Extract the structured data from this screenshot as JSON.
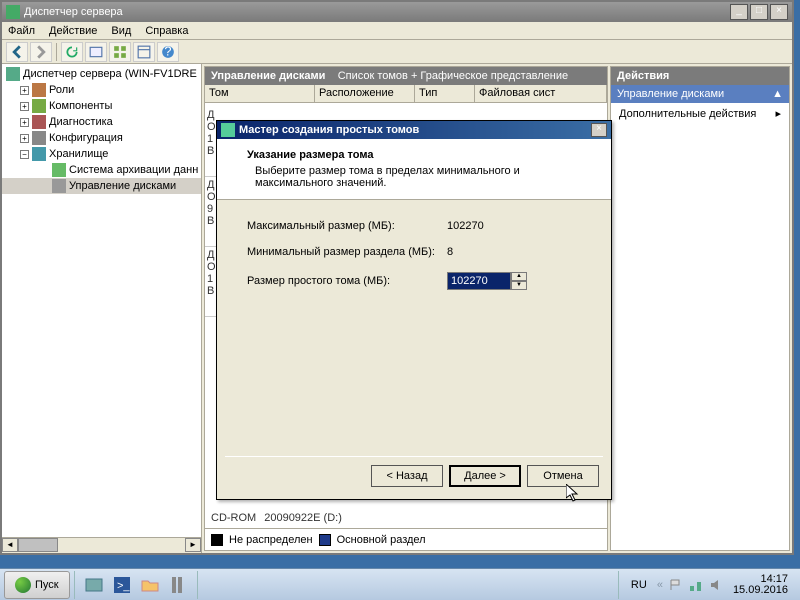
{
  "window": {
    "title": "Диспетчер сервера"
  },
  "winbuttons": {
    "min": "_",
    "max": "□",
    "close": "×"
  },
  "menu": {
    "file": "Файл",
    "action": "Действие",
    "view": "Вид",
    "help": "Справка"
  },
  "tree": {
    "root": "Диспетчер сервера (WIN-FV1DRE",
    "roles": "Роли",
    "components": "Компоненты",
    "diagnostics": "Диагностика",
    "config": "Конфигурация",
    "storage": "Хранилище",
    "backup": "Система архивации данн",
    "diskmgmt": "Управление дисками"
  },
  "diskheader": {
    "title": "Управление дисками",
    "subtitle": "Список томов + Графическое представление"
  },
  "cols": {
    "tom": "Том",
    "layout": "Расположение",
    "type": "Тип",
    "fs": "Файловая сист"
  },
  "stubs": {
    "d0a": "Д",
    "d0b": "О",
    "d0c": "1",
    "d0d": "В",
    "d1a": "Д",
    "d1b": "О",
    "d1c": "9",
    "d1d": "В",
    "d2a": "Д",
    "d2b": "О",
    "d2c": "1",
    "d2d": "В"
  },
  "cdrom": {
    "a": "CD-ROM",
    "b": "20090922E (D:)"
  },
  "legend": {
    "unalloc": "Не распределен",
    "primary": "Основной раздел"
  },
  "actions": {
    "title": "Действия",
    "diskmgmt": "Управление дисками",
    "more": "Дополнительные действия",
    "arrow": "▲",
    "chev": "▸"
  },
  "wizard": {
    "title": "Мастер создания простых томов",
    "heading": "Указание размера тома",
    "sub": "Выберите размер тома в пределах минимального и максимального значений.",
    "max_label": "Максимальный размер (МБ):",
    "max_val": "102270",
    "min_label": "Минимальный размер раздела (МБ):",
    "min_val": "8",
    "size_label": "Размер простого тома (МБ):",
    "size_val": "102270",
    "back": "< Назад",
    "next": "Далее >",
    "cancel": "Отмена",
    "close": "×",
    "up": "▲",
    "down": "▼"
  },
  "taskbar": {
    "start": "Пуск",
    "lang": "RU",
    "time": "14:17",
    "date": "15.09.2016"
  }
}
